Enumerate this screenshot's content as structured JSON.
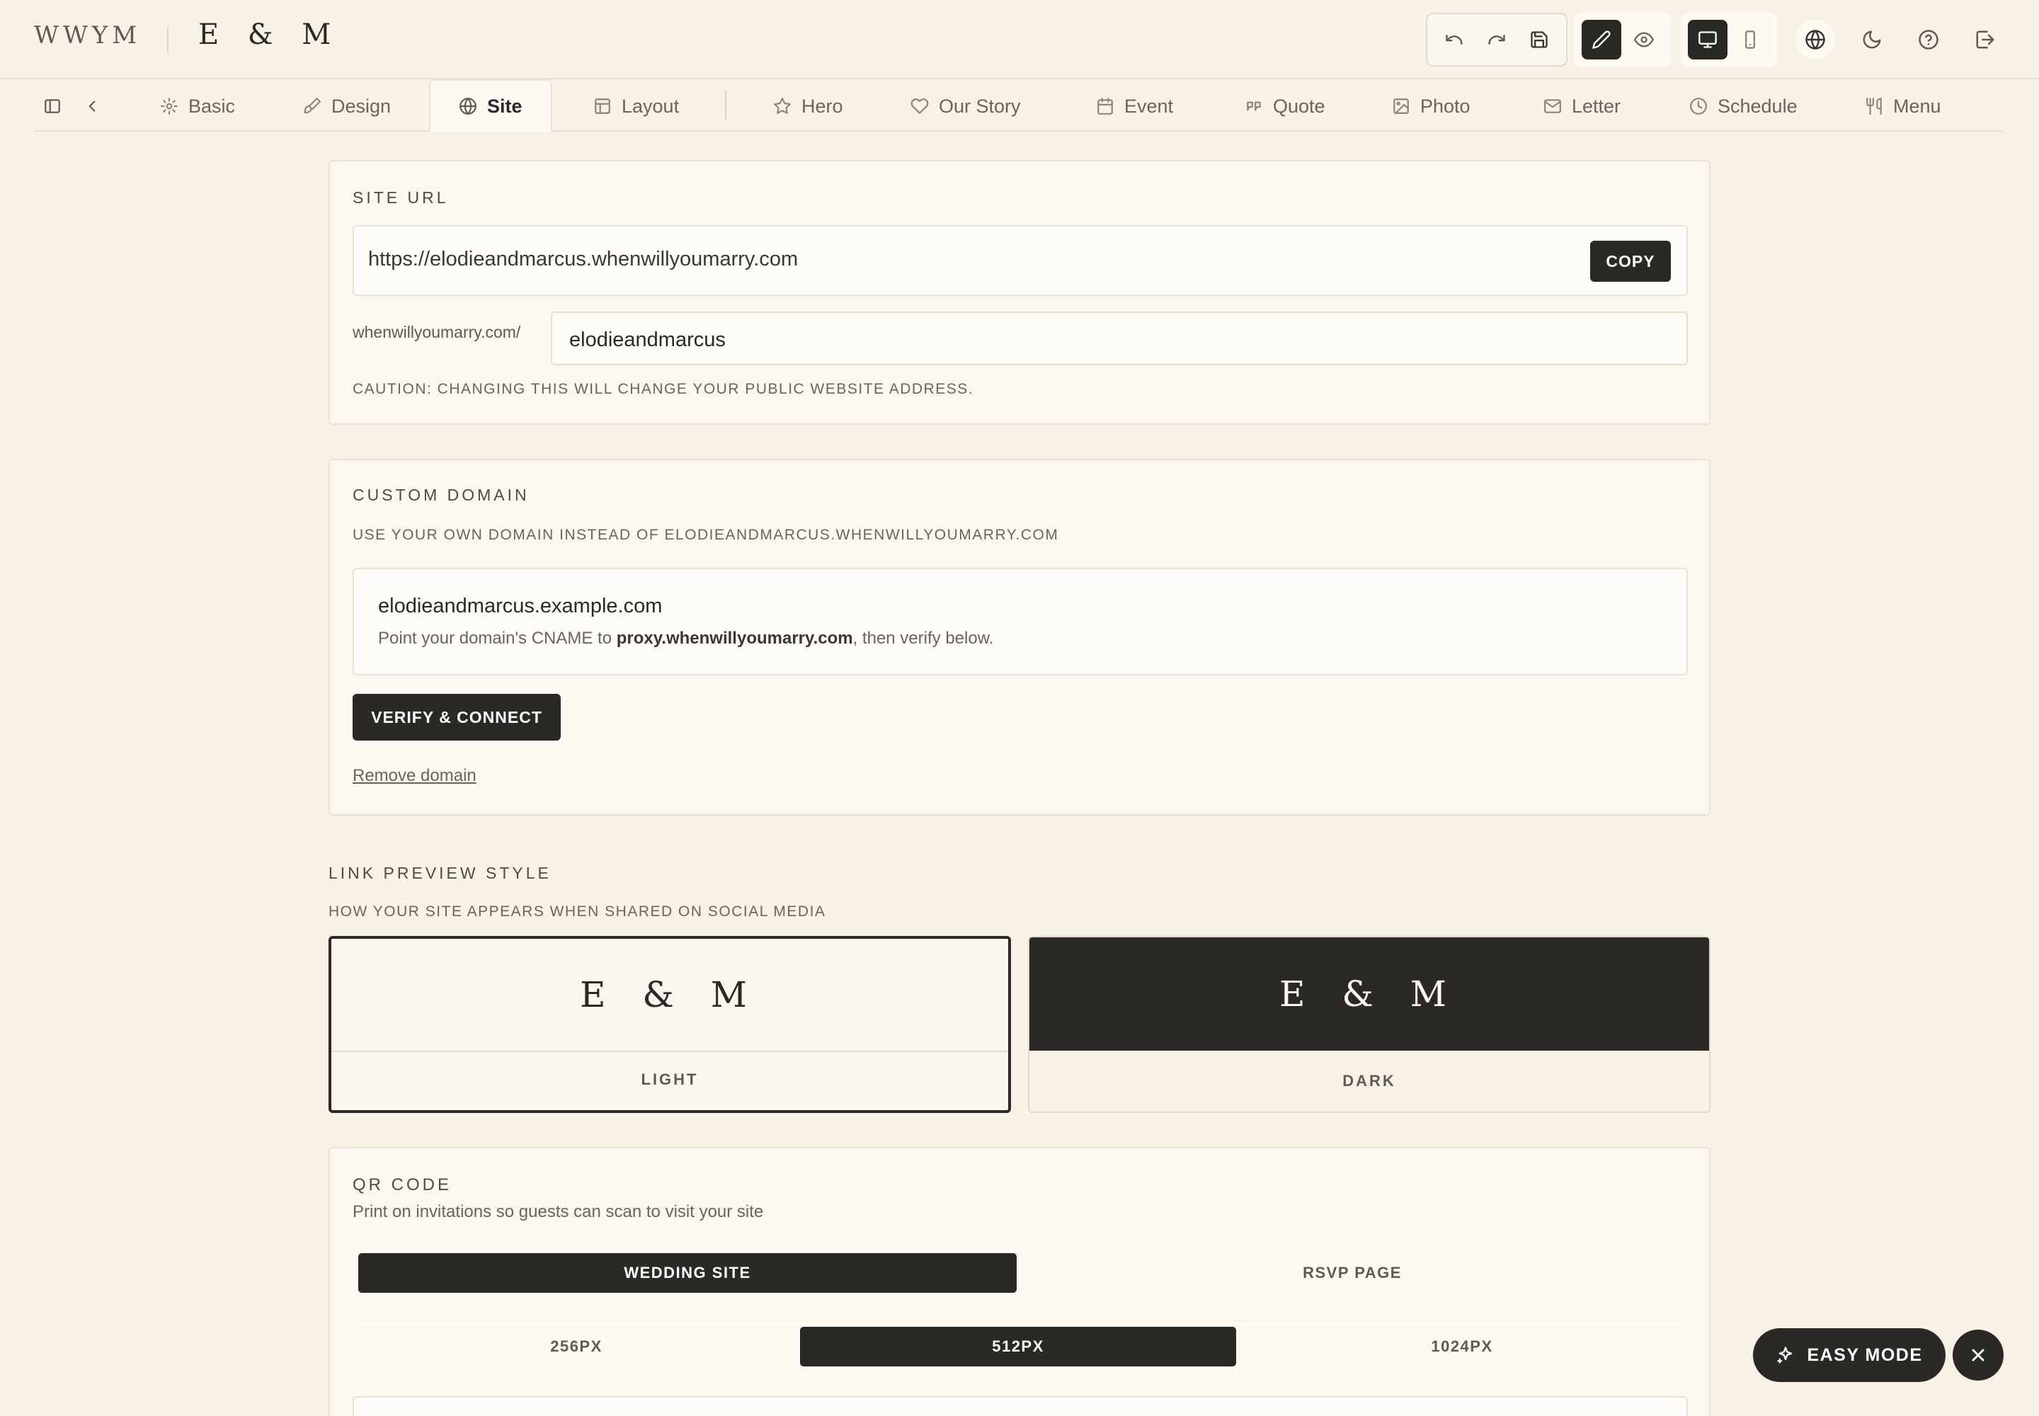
{
  "header": {
    "brand": "WWYM",
    "monogram": "E & M"
  },
  "tabs": [
    {
      "label": "Basic",
      "icon": "gear-icon"
    },
    {
      "label": "Design",
      "icon": "brush-icon"
    },
    {
      "label": "Site",
      "icon": "globe-icon",
      "active": true
    },
    {
      "label": "Layout",
      "icon": "layout-icon"
    },
    {
      "label": "Hero",
      "icon": "star-icon"
    },
    {
      "label": "Our Story",
      "icon": "heart-icon"
    },
    {
      "label": "Event",
      "icon": "calendar-icon"
    },
    {
      "label": "Quote",
      "icon": "quote-icon"
    },
    {
      "label": "Photo",
      "icon": "image-icon"
    },
    {
      "label": "Letter",
      "icon": "mail-icon"
    },
    {
      "label": "Schedule",
      "icon": "clock-icon"
    },
    {
      "label": "Menu",
      "icon": "utensils-icon"
    }
  ],
  "site_url": {
    "heading": "SITE URL",
    "url": "https://elodieandmarcus.whenwillyoumarry.com",
    "copy_label": "COPY",
    "prefix": "whenwillyoumarry.com/",
    "slug": "elodieandmarcus",
    "caution": "CAUTION: CHANGING THIS WILL CHANGE YOUR PUBLIC WEBSITE ADDRESS."
  },
  "custom_domain": {
    "heading": "CUSTOM DOMAIN",
    "subtitle": "USE YOUR OWN DOMAIN INSTEAD OF ELODIEANDMARCUS.WHENWILLYOUMARRY.COM",
    "domain": "elodieandmarcus.example.com",
    "help_before": "Point your domain's CNAME to ",
    "help_target": "proxy.whenwillyoumarry.com",
    "help_after": ", then verify below.",
    "verify_label": "VERIFY & CONNECT",
    "remove_label": "Remove domain"
  },
  "link_preview": {
    "heading": "LINK PREVIEW STYLE",
    "subtitle": "HOW YOUR SITE APPEARS WHEN SHARED ON SOCIAL MEDIA",
    "options": [
      {
        "monogram": "E & M",
        "label": "LIGHT",
        "selected": true
      },
      {
        "monogram": "E & M",
        "label": "DARK",
        "selected": false
      }
    ]
  },
  "qr": {
    "heading": "QR CODE",
    "subtitle": "Print on invitations so guests can scan to visit your site",
    "targets": [
      "WEDDING SITE",
      "RSVP PAGE"
    ],
    "active_target": "WEDDING SITE",
    "sizes": [
      "256PX",
      "512PX",
      "1024PX"
    ],
    "active_size": "512PX"
  },
  "floating": {
    "easy_mode_label": "EASY MODE"
  },
  "colors": {
    "background": "#f8f1e5",
    "card": "#fcf8f1",
    "accent_dark": "#2b2926",
    "border": "#ece2d3"
  }
}
